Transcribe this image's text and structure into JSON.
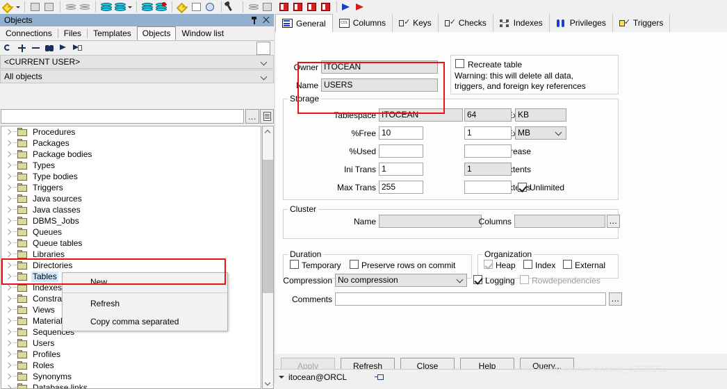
{
  "toolbar": {
    "groups": [
      {
        "items": [
          {
            "icon": "key-icon"
          },
          {
            "icon": "dropdown-caret"
          }
        ]
      },
      {
        "items": [
          {
            "icon": "gear-disabled-icon"
          },
          {
            "icon": "lightning-disabled-icon"
          }
        ]
      },
      {
        "items": [
          {
            "icon": "commit-disabled-icon"
          },
          {
            "icon": "rollback-disabled-icon"
          }
        ]
      },
      {
        "items": [
          {
            "icon": "database-icon"
          },
          {
            "icon": "database-open-icon"
          },
          {
            "icon": "dropdown-caret"
          }
        ]
      },
      {
        "items": [
          {
            "icon": "database-connect-icon"
          },
          {
            "icon": "database-disconnect-icon"
          }
        ]
      },
      {
        "items": [
          {
            "icon": "keys-icon"
          },
          {
            "icon": "checklist-icon"
          },
          {
            "icon": "history-icon"
          }
        ]
      },
      {
        "items": [
          {
            "icon": "wrench-icon"
          }
        ]
      },
      {
        "items": [
          {
            "icon": "object-disabled-icon"
          },
          {
            "icon": "eraser-disabled-icon"
          }
        ]
      },
      {
        "items": [
          {
            "icon": "book-red-icon"
          },
          {
            "icon": "book-open-icon"
          },
          {
            "icon": "book-add-icon"
          },
          {
            "icon": "book-del-icon"
          }
        ]
      },
      {
        "items": [
          {
            "icon": "arrow-blue-icon"
          },
          {
            "icon": "arrow-red-icon"
          }
        ]
      }
    ]
  },
  "objects_panel": {
    "title": "Objects",
    "pin_icon": "pin-icon",
    "close_icon": "close-icon",
    "tabs": [
      {
        "label": "Connections",
        "selected": false
      },
      {
        "label": "Files",
        "selected": false
      },
      {
        "label": "Templates",
        "selected": false
      },
      {
        "label": "Objects",
        "selected": true
      },
      {
        "label": "Window list",
        "selected": false
      }
    ],
    "tree_tools": [
      {
        "icon": "refresh-icon"
      },
      {
        "icon": "expand-plus-icon"
      },
      {
        "icon": "collapse-minus-icon"
      },
      {
        "icon": "find-binoculars-icon"
      },
      {
        "icon": "goto-flag-icon"
      },
      {
        "icon": "goto-copy-icon"
      }
    ],
    "user_filter": {
      "value": "<CURRENT USER>"
    },
    "object_filter": {
      "value": "All objects"
    },
    "search": {
      "value": "",
      "placeholder": ""
    },
    "search_dots_button": "...",
    "search_script_icon": "script-icon",
    "tree_items": [
      {
        "label": "Procedures",
        "selected": false
      },
      {
        "label": "Packages",
        "selected": false
      },
      {
        "label": "Package bodies",
        "selected": false
      },
      {
        "label": "Types",
        "selected": false
      },
      {
        "label": "Type bodies",
        "selected": false
      },
      {
        "label": "Triggers",
        "selected": false
      },
      {
        "label": "Java sources",
        "selected": false
      },
      {
        "label": "Java classes",
        "selected": false
      },
      {
        "label": "DBMS_Jobs",
        "selected": false
      },
      {
        "label": "Queues",
        "selected": false
      },
      {
        "label": "Queue tables",
        "selected": false
      },
      {
        "label": "Libraries",
        "selected": false
      },
      {
        "label": "Directories",
        "selected": false
      },
      {
        "label": "Tables",
        "selected": true
      },
      {
        "label": "Indexes",
        "selected": false
      },
      {
        "label": "Constraints",
        "selected": false
      },
      {
        "label": "Views",
        "selected": false
      },
      {
        "label": "Materialized views",
        "selected": false
      },
      {
        "label": "Sequences",
        "selected": false
      },
      {
        "label": "Users",
        "selected": false
      },
      {
        "label": "Profiles",
        "selected": false
      },
      {
        "label": "Roles",
        "selected": false
      },
      {
        "label": "Synonyms",
        "selected": false
      },
      {
        "label": "Database links",
        "selected": false
      }
    ],
    "context_menu": [
      {
        "label": "New...",
        "type": "item"
      },
      {
        "type": "separator"
      },
      {
        "label": "Refresh",
        "type": "item"
      },
      {
        "label": "Copy comma separated",
        "type": "item"
      }
    ]
  },
  "editor": {
    "tabs": [
      {
        "label": "General",
        "icon": "general-icon",
        "selected": true
      },
      {
        "label": "Columns",
        "icon": "columns-icon",
        "selected": false
      },
      {
        "label": "Keys",
        "icon": "keys-icon",
        "selected": false
      },
      {
        "label": "Checks",
        "icon": "checks-icon",
        "selected": false
      },
      {
        "label": "Indexes",
        "icon": "indexes-icon",
        "selected": false
      },
      {
        "label": "Privileges",
        "icon": "privileges-icon",
        "selected": false
      },
      {
        "label": "Triggers",
        "icon": "triggers-icon",
        "selected": false
      }
    ],
    "owner": {
      "label": "Owner",
      "value": "ITOCEAN"
    },
    "name": {
      "label": "Name",
      "value": "USERS"
    },
    "recreate": {
      "label": "Recreate table",
      "checked": false,
      "warning_line1": "Warning: this will delete all data,",
      "warning_line2": "triggers, and foreign key references"
    },
    "storage": {
      "legend": "Storage",
      "tablespace": {
        "label": "Tablespace",
        "value": "ITOCEAN"
      },
      "pct_free": {
        "label": "%Free",
        "value": "10"
      },
      "pct_used": {
        "label": "%Used",
        "value": ""
      },
      "ini_trans": {
        "label": "Ini Trans",
        "value": "1"
      },
      "max_trans": {
        "label": "Max Trans",
        "value": "255"
      },
      "initial_extent": {
        "label": "Initial Extent",
        "value": "64",
        "unit": "KB"
      },
      "next_extent": {
        "label": "Next Extent",
        "value": "1",
        "unit": "MB"
      },
      "pct_increase": {
        "label": "%Increase",
        "value": ""
      },
      "min_extents": {
        "label": "Min Extents",
        "value": "1"
      },
      "max_extents": {
        "label": "Max Extents",
        "value": ""
      },
      "unlimited": {
        "label": "Unlimited",
        "checked": true
      }
    },
    "cluster": {
      "legend": "Cluster",
      "name": {
        "label": "Name",
        "value": ""
      },
      "columns": {
        "label": "Columns",
        "value": ""
      },
      "columns_button": "..."
    },
    "duration": {
      "legend": "Duration",
      "temporary": {
        "label": "Temporary",
        "checked": false
      },
      "preserve": {
        "label": "Preserve rows on commit",
        "checked": false
      }
    },
    "organization": {
      "legend": "Organization",
      "heap": {
        "label": "Heap",
        "checked": true
      },
      "index": {
        "label": "Index",
        "checked": false
      },
      "external": {
        "label": "External",
        "checked": false
      }
    },
    "compression": {
      "label": "Compression",
      "value": "No compression"
    },
    "logging": {
      "label": "Logging",
      "checked": true
    },
    "rowdependencies": {
      "label": "Rowdependencies",
      "checked": false
    },
    "comments": {
      "label": "Comments",
      "value": "",
      "button": "..."
    },
    "buttons": [
      {
        "label": "Apply",
        "accel": "A",
        "disabled": true
      },
      {
        "label": "Refresh",
        "accel": "R",
        "disabled": false
      },
      {
        "label": "Close",
        "accel": "C",
        "disabled": false
      },
      {
        "label": "Help",
        "accel": "H",
        "disabled": false
      },
      {
        "label": "Query...",
        "accel": "Q",
        "disabled": false
      }
    ]
  },
  "status_bar": {
    "connection": "itocean@ORCL",
    "plug_icon": "connection-icon"
  },
  "watermark": "https://blog.csdn.net/weixin_42330251",
  "colors": {
    "panel_header": "#94b0cf",
    "highlight_red": "#ee1111",
    "selection_blue": "#cde8ff",
    "folder_yellow": "#d9d9a0"
  }
}
